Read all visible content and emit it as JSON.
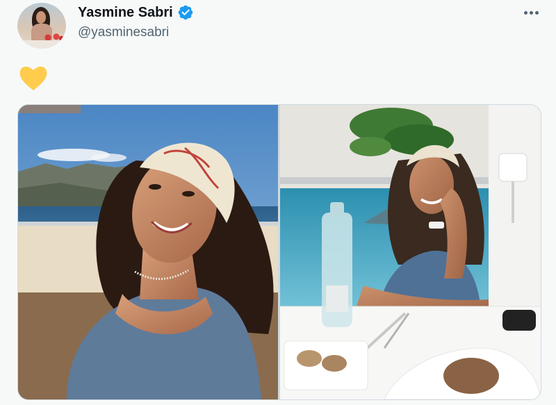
{
  "author": {
    "display_name": "Yasmine Sabri",
    "handle": "@yasminesabri",
    "verified": true,
    "avatar_icon": "profile-photo"
  },
  "tweet": {
    "text": "💛"
  },
  "media": {
    "count": 2,
    "items": [
      {
        "kind": "photo",
        "subject": "woman-headscarf-yacht-selfie"
      },
      {
        "kind": "photo",
        "subject": "woman-headscarf-seaside-table"
      }
    ]
  },
  "icons": {
    "verified": "verified-badge-icon",
    "more": "more-options-icon",
    "heart": "yellow-heart-emoji"
  },
  "colors": {
    "background": "#f7f9f9",
    "verified_blue": "#1d9bf0",
    "heart_yellow": "#ffcc4d",
    "handle_gray": "#536471"
  }
}
